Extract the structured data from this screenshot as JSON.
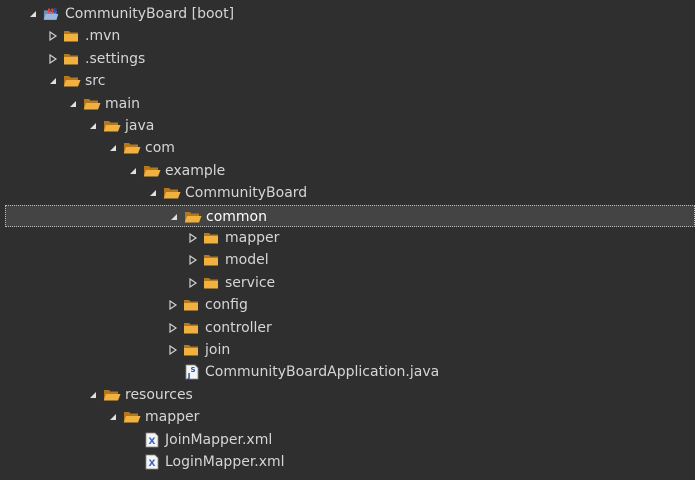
{
  "tree": {
    "rows": [
      {
        "label": "CommunityBoard [boot]",
        "arrow": "expanded",
        "icon": "project",
        "level": 0
      },
      {
        "label": ".mvn",
        "arrow": "collapsed",
        "icon": "folder",
        "level": 1
      },
      {
        "label": ".settings",
        "arrow": "collapsed",
        "icon": "folder",
        "level": 1
      },
      {
        "label": "src",
        "arrow": "expanded",
        "icon": "folder-open",
        "level": 1
      },
      {
        "label": "main",
        "arrow": "expanded",
        "icon": "folder-open",
        "level": 2
      },
      {
        "label": "java",
        "arrow": "expanded",
        "icon": "folder-open",
        "level": 3
      },
      {
        "label": "com",
        "arrow": "expanded",
        "icon": "folder-open",
        "level": 4
      },
      {
        "label": "example",
        "arrow": "expanded",
        "icon": "folder-open",
        "level": 5
      },
      {
        "label": "CommunityBoard",
        "arrow": "expanded",
        "icon": "folder-open",
        "level": 6
      },
      {
        "label": "common",
        "arrow": "expanded",
        "icon": "folder-open",
        "level": 7,
        "selected": true
      },
      {
        "label": "mapper",
        "arrow": "collapsed",
        "icon": "folder",
        "level": 8
      },
      {
        "label": "model",
        "arrow": "collapsed",
        "icon": "folder",
        "level": 8
      },
      {
        "label": "service",
        "arrow": "collapsed",
        "icon": "folder",
        "level": 8
      },
      {
        "label": "config",
        "arrow": "collapsed",
        "icon": "folder",
        "level": 7
      },
      {
        "label": "controller",
        "arrow": "collapsed",
        "icon": "folder",
        "level": 7
      },
      {
        "label": "join",
        "arrow": "collapsed",
        "icon": "folder",
        "level": 7
      },
      {
        "label": "CommunityBoardApplication.java",
        "arrow": "none",
        "icon": "java-file",
        "level": 7
      },
      {
        "label": "resources",
        "arrow": "expanded",
        "icon": "folder-open",
        "level": 3
      },
      {
        "label": "mapper",
        "arrow": "expanded",
        "icon": "folder-open",
        "level": 4
      },
      {
        "label": "JoinMapper.xml",
        "arrow": "none",
        "icon": "xml-file",
        "level": 5
      },
      {
        "label": "LoginMapper.xml",
        "arrow": "none",
        "icon": "xml-file",
        "level": 5
      }
    ]
  },
  "colors": {
    "background": "#2f2f2f",
    "text": "#d6d6d6",
    "selection": "#444444",
    "folder": "#e8a83a",
    "arrow": "#cfcfcf"
  }
}
